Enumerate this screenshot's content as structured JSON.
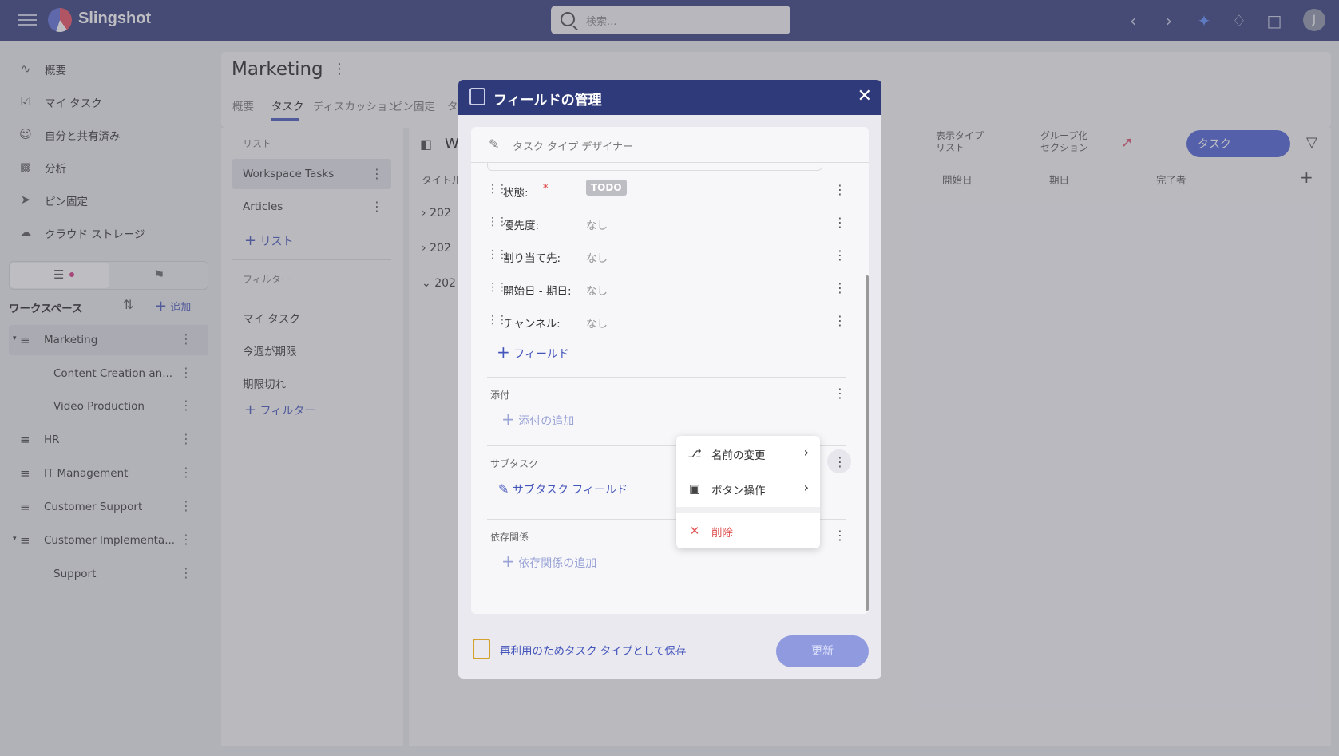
{
  "app": {
    "name": "Slingshot"
  },
  "search": {
    "placeholder": "検索..."
  },
  "topbar": {
    "avatar_initial": "J"
  },
  "nav": [
    {
      "label": "概要",
      "icon": "activity-icon"
    },
    {
      "label": "マイ タスク",
      "icon": "clipboard-check-icon"
    },
    {
      "label": "自分と共有済み",
      "icon": "user-share-icon"
    },
    {
      "label": "分析",
      "icon": "bar-chart-icon"
    },
    {
      "label": "ピン固定",
      "icon": "pin-icon"
    },
    {
      "label": "クラウド ストレージ",
      "icon": "cloud-icon"
    }
  ],
  "workspaces": {
    "title": "ワークスペース",
    "add_label": "追加",
    "items": [
      {
        "label": "Marketing",
        "level": 0,
        "expanded": true,
        "active": true
      },
      {
        "label": "Content Creation an...",
        "level": 1
      },
      {
        "label": "Video Production",
        "level": 1
      },
      {
        "label": "HR",
        "level": 0
      },
      {
        "label": "IT Management",
        "level": 0
      },
      {
        "label": "Customer Support",
        "level": 0
      },
      {
        "label": "Customer Implementa...",
        "level": 0,
        "expanded": true
      },
      {
        "label": "Support",
        "level": 1
      }
    ]
  },
  "project": {
    "title": "Marketing",
    "tabs": [
      "概要",
      "タスク",
      "ディスカッション",
      "ピン固定",
      "タ"
    ],
    "active_tab": "タスク"
  },
  "lists": {
    "section_title": "リスト",
    "items": [
      "Workspace Tasks",
      "Articles"
    ],
    "add_label": "リスト",
    "filter_title": "フィルター",
    "filters": [
      "マイ タスク",
      "今週が期限",
      "期限切れ"
    ],
    "add_filter_label": "フィルター"
  },
  "tasks": {
    "title_partial": "W",
    "column_title": "タイトル",
    "columns": [
      "開始日",
      "期日",
      "完了者"
    ],
    "view_type_label": "表示タイプ",
    "view_type_value": "リスト",
    "group_label": "グループ化",
    "group_value": "セクション",
    "add_task_label": "タスク",
    "group_rows": [
      "202",
      "202",
      "202"
    ]
  },
  "dialog": {
    "title": "フィールドの管理",
    "designer_label": "タスク タイプ デザイナー",
    "fields": [
      {
        "name": "状態:",
        "required_mark": "*",
        "value": "TODO",
        "badge": true
      },
      {
        "name": "優先度:",
        "value": "なし"
      },
      {
        "name": "割り当て先:",
        "value": "なし"
      },
      {
        "name": "開始日 - 期日:",
        "value": "なし"
      },
      {
        "name": "チャンネル:",
        "value": "なし"
      }
    ],
    "add_field_label": "フィールド",
    "attachments": {
      "title": "添付",
      "add_label": "添付の追加"
    },
    "subtasks": {
      "title": "サブタスク",
      "field_label": "サブタスク フィールド"
    },
    "dependencies": {
      "title": "依存関係",
      "add_label": "依存関係の追加"
    },
    "save_as_type_label": "再利用のためタスク タイプとして保存",
    "update_label": "更新"
  },
  "context_menu": {
    "items": [
      {
        "label": "名前の変更",
        "icon": "rename-icon",
        "submenu": true
      },
      {
        "label": "ボタン操作",
        "icon": "button-action-icon",
        "submenu": true
      },
      {
        "label": "削除",
        "icon": "close-icon",
        "danger": true
      }
    ],
    "danger_color": "#e05555"
  },
  "colors": {
    "brand": "#2f3a7a",
    "accent": "#4455bb",
    "button_disabled": "#8f9adf"
  }
}
